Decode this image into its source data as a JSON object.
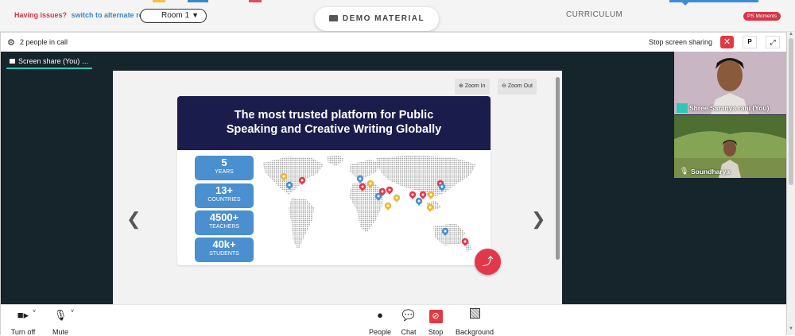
{
  "topbar": {
    "issue_text": "Having issues?",
    "alternate_link": "switch to alternate room",
    "room_select": "Room 1",
    "demo_material": "DEMO MATERIAL",
    "curriculum": "CURRICULUM",
    "ps_moments": "PS Moments"
  },
  "callbar": {
    "people_in_call": "2 people in call",
    "stop_sharing": "Stop screen sharing",
    "p_label": "P"
  },
  "share": {
    "tab_label": "Screen share (You)",
    "tab_menu": "…",
    "zoom_in": "Zoom In",
    "zoom_out": "Zoom Out"
  },
  "slide": {
    "title_line1": "The most trusted platform for Public",
    "title_line2": "Speaking and Creative Writing Globally",
    "stats": [
      {
        "value": "5",
        "label": "YEARS"
      },
      {
        "value": "13+",
        "label": "COUNTRIES"
      },
      {
        "value": "4500+",
        "label": "TEACHERS"
      },
      {
        "value": "40k+",
        "label": "STUDENTS"
      }
    ]
  },
  "participants": [
    {
      "name": "Shree Saranya rani (You)"
    },
    {
      "name": "Soundharya"
    }
  ],
  "controls": {
    "turn_off": "Turn off",
    "mute": "Mute",
    "people": "People",
    "chat": "Chat",
    "stop": "Stop",
    "background": "Background"
  },
  "colors": {
    "accent_red": "#e2384b",
    "teal": "#2fc7b7",
    "slide_navy": "#1a1d4c",
    "stat_blue": "#4a8fcf",
    "stage_dark": "#16242c"
  }
}
